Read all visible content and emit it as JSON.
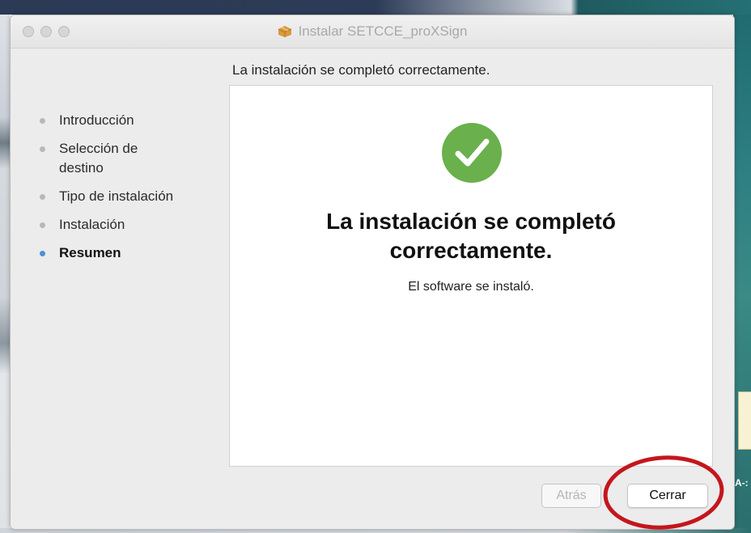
{
  "window": {
    "title": "Instalar SETCCE_proXSign",
    "subtitle": "La instalación se completó correctamente."
  },
  "sidebar": {
    "items": [
      {
        "label": "Introducción",
        "active": false
      },
      {
        "label": "Selección de destino",
        "active": false
      },
      {
        "label": "Tipo de instalación",
        "active": false
      },
      {
        "label": "Instalación",
        "active": false
      },
      {
        "label": "Resumen",
        "active": true
      }
    ]
  },
  "main": {
    "status_icon": "checkmark-circle-icon",
    "headline_line1": "La instalación se completó",
    "headline_line2": "correctamente.",
    "message": "El software se instaló."
  },
  "buttons": {
    "back_label": "Atrás",
    "back_enabled": false,
    "close_label": "Cerrar"
  },
  "colors": {
    "success_green": "#6ab04c",
    "active_step_dot": "#4a90d9",
    "annotation_red": "#c4161c"
  },
  "desktop": {
    "right_edge_text": "A-:"
  }
}
